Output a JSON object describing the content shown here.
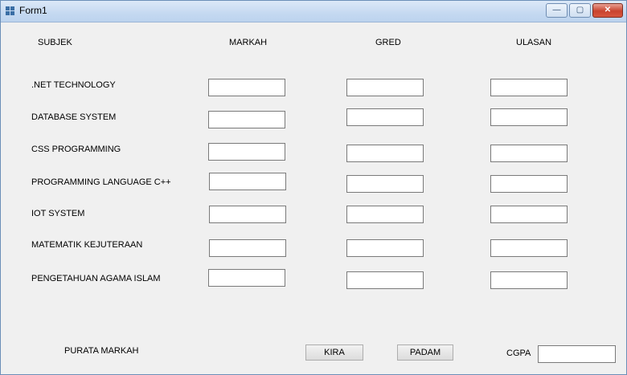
{
  "window": {
    "title": "Form1",
    "minimize_glyph": "—",
    "maximize_glyph": "▢",
    "close_glyph": "✕"
  },
  "headers": {
    "subject": "SUBJEK",
    "marks": "MARKAH",
    "grade": "GRED",
    "remarks": "ULASAN"
  },
  "subjects": [
    {
      "name": ".NET TECHNOLOGY",
      "markah": "",
      "gred": "",
      "ulasan": ""
    },
    {
      "name": "DATABASE SYSTEM",
      "markah": "",
      "gred": "",
      "ulasan": ""
    },
    {
      "name": "CSS PROGRAMMING",
      "markah": "",
      "gred": "",
      "ulasan": ""
    },
    {
      "name": "PROGRAMMING LANGUAGE C++",
      "markah": "",
      "gred": "",
      "ulasan": ""
    },
    {
      "name": "IOT SYSTEM",
      "markah": "",
      "gred": "",
      "ulasan": ""
    },
    {
      "name": "MATEMATIK KEJUTERAAN",
      "markah": "",
      "gred": "",
      "ulasan": ""
    },
    {
      "name": "PENGETAHUAN AGAMA ISLAM",
      "markah": "",
      "gred": "",
      "ulasan": ""
    }
  ],
  "footer": {
    "average_label": "PURATA MARKAH",
    "calculate_label": "KIRA",
    "clear_label": "PADAM",
    "cgpa_label": "CGPA",
    "cgpa_value": ""
  }
}
